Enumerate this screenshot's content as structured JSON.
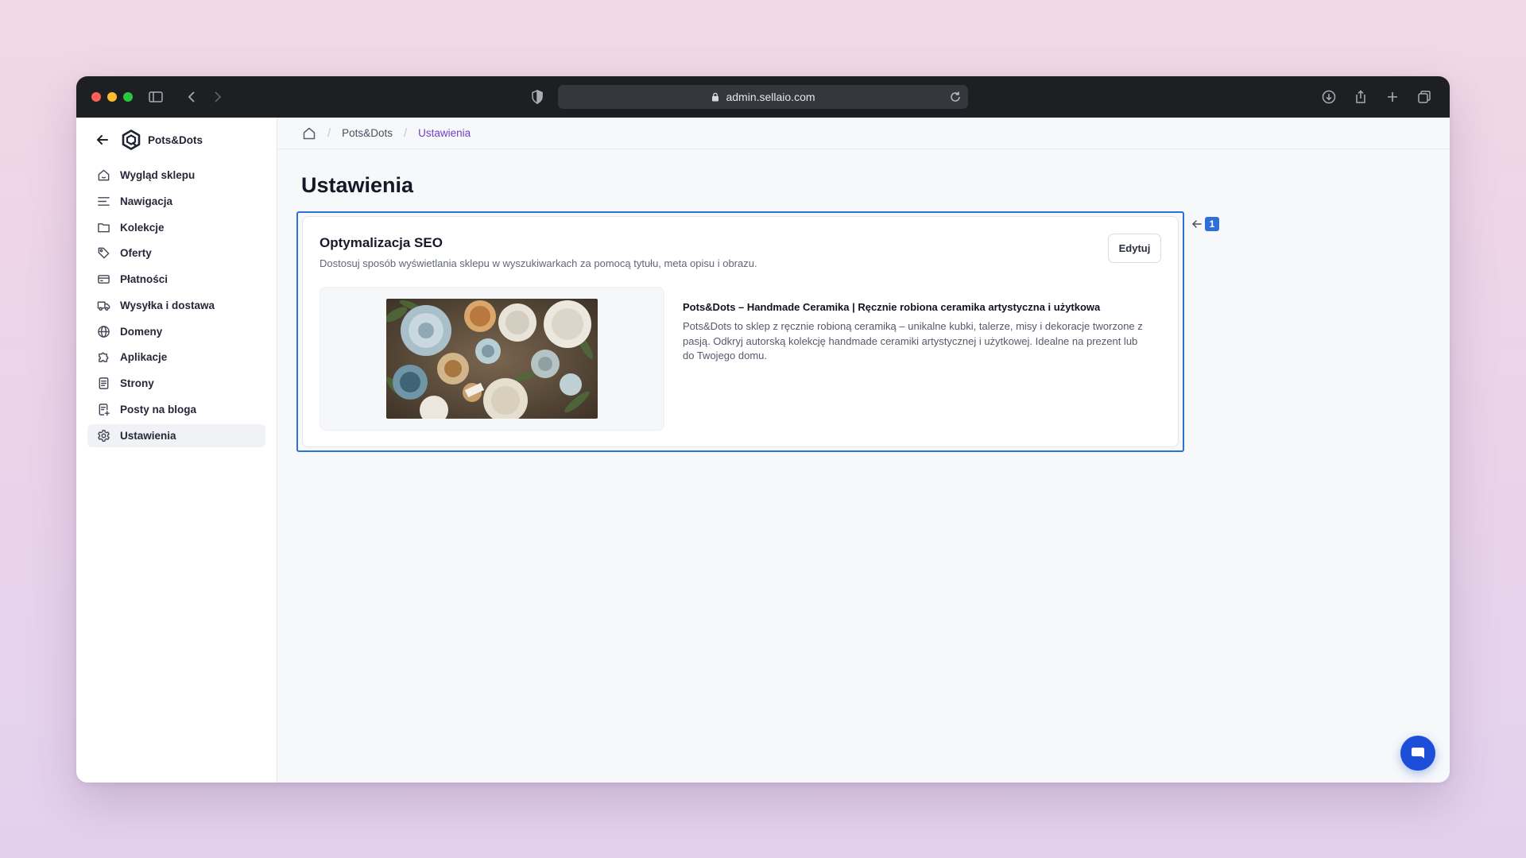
{
  "browser": {
    "url": "admin.sellaio.com"
  },
  "brand": {
    "name": "Pots&Dots"
  },
  "sidebar": {
    "items": [
      {
        "label": "Wygląd sklepu",
        "icon": "storefront-icon"
      },
      {
        "label": "Nawigacja",
        "icon": "menu-lines-icon"
      },
      {
        "label": "Kolekcje",
        "icon": "folder-icon"
      },
      {
        "label": "Oferty",
        "icon": "tag-icon"
      },
      {
        "label": "Płatności",
        "icon": "credit-card-icon"
      },
      {
        "label": "Wysyłka i dostawa",
        "icon": "truck-icon"
      },
      {
        "label": "Domeny",
        "icon": "globe-icon"
      },
      {
        "label": "Aplikacje",
        "icon": "puzzle-icon"
      },
      {
        "label": "Strony",
        "icon": "page-icon"
      },
      {
        "label": "Posty na bloga",
        "icon": "blog-post-icon"
      },
      {
        "label": "Ustawienia",
        "icon": "gear-icon",
        "active": true
      }
    ]
  },
  "breadcrumb": {
    "items": [
      "Pots&Dots",
      "Ustawienia"
    ]
  },
  "page": {
    "title": "Ustawienia"
  },
  "seo_card": {
    "title": "Optymalizacja SEO",
    "description": "Dostosuj sposób wyświetlania sklepu w wyszukiwarkach za pomocą tytułu, meta opisu i obrazu.",
    "edit_label": "Edytuj",
    "preview_title": "Pots&Dots – Handmade Ceramika | Ręcznie robiona ceramika artystyczna i użytkowa",
    "preview_description": "Pots&Dots to sklep z ręcznie robioną ceramiką – unikalne kubki, talerze, misy i dekoracje tworzone z pasją. Odkryj autorską kolekcję handmade ceramiki artystycznej i użytkowej. Idealne na prezent lub do Twojego domu."
  },
  "annotation": {
    "badge": "1"
  },
  "colors": {
    "accent": "#6d40c8",
    "highlight": "#2f6fd8",
    "chat": "#1d4ed8"
  }
}
